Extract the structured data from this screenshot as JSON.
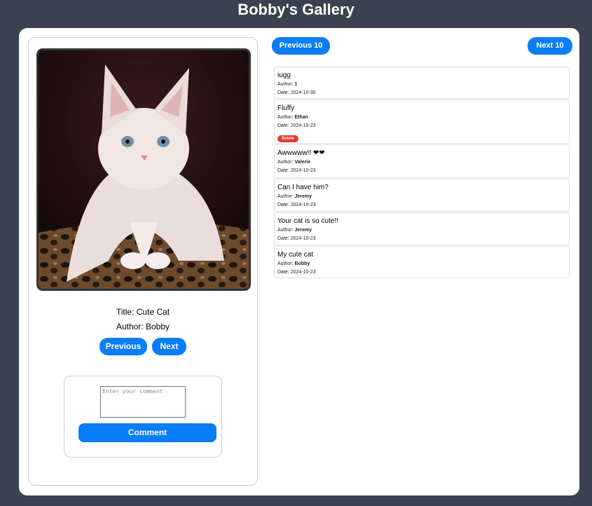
{
  "header": {
    "title": "Bobby's Gallery"
  },
  "photo": {
    "title_line": "Title: Cute Cat",
    "author_line": "Author: Bobby",
    "image_alt": "cat-photo"
  },
  "photo_nav": {
    "previous_label": "Previous",
    "next_label": "Next"
  },
  "comment_form": {
    "placeholder": "Enter your comment",
    "value": "",
    "submit_label": "Comment"
  },
  "comments_nav": {
    "previous_label": "Previous 10",
    "next_label": "Next 10"
  },
  "author_prefix": "Author: ",
  "date_prefix": "Date: ",
  "delete_label": "Delete",
  "comments": [
    {
      "text": "iugg",
      "author": "1",
      "date": "2024-10-30",
      "deletable": false
    },
    {
      "text": "Fluffy",
      "author": "Ethan",
      "date": "2024-10-23",
      "deletable": true
    },
    {
      "text": "Awwwww!! ❤❤",
      "author": "Valerie",
      "date": "2024-10-23",
      "deletable": false
    },
    {
      "text": "Can I have him?",
      "author": "Jeremy",
      "date": "2024-10-23",
      "deletable": false
    },
    {
      "text": "Your cat is so cute!!",
      "author": "Jeremy",
      "date": "2024-10-23",
      "deletable": false
    },
    {
      "text": "My cute cat",
      "author": "Bobby",
      "date": "2024-10-23",
      "deletable": false
    }
  ],
  "colors": {
    "background": "#3a4250",
    "accent": "#0a7df8",
    "danger": "#e53935"
  }
}
